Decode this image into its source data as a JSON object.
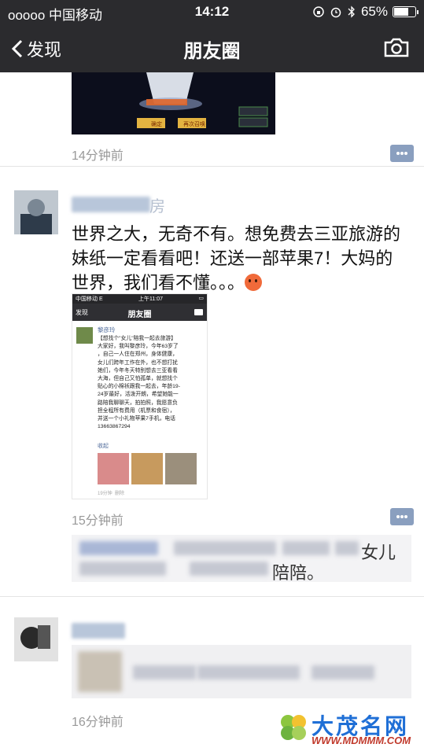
{
  "status_bar": {
    "carrier": "ooooo 中国移动",
    "time": "14:12",
    "battery": "65%",
    "battery_level": 0.65
  },
  "nav": {
    "back_label": "发现",
    "title": "朋友圈",
    "camera_icon": "camera-icon"
  },
  "posts": [
    {
      "timestamp": "14分钟前",
      "image_labels": {
        "button_a": "确定",
        "button_b": "再次召唤"
      }
    },
    {
      "name_suffix": "房",
      "text": "世界之大，无奇不有。想免费去三亚旅游的妹纸一定看看吧！还送一部苹果7！大妈的世界，我们看不懂。。。",
      "timestamp": "15分钟前",
      "shot": {
        "carrier": "中国移动 E",
        "time": "上午11:07",
        "back": "发现",
        "title": "朋友圈",
        "name": "黎彦玲",
        "body": "【想找个\"女儿\"陪我一起去旅游】\n大家好，我叫黎彦玲，今年63岁了\n，自己一人住在郑州，身体健康，\n女儿们跨年工作在外，也不想打扰\n她们，今年冬天特别想去三亚看看\n大海，但自己又怕孤单，就想找个\n贴心的小棉袄跟我一起去，年龄19-\n24岁最好，活泼开朗，希望她能一\n路陪我聊聊天，拍拍照，我愿意负\n担全程所有费用（机票和食宿），\n并送一个小礼物苹果7手机，电话\n13663867294",
        "collapse": "收起",
        "time_ago": "19分钟",
        "delete": "删除"
      },
      "comment_visible": [
        "女儿",
        "陪陪。"
      ]
    },
    {
      "timestamp": "16分钟前"
    }
  ],
  "watermark": {
    "title": "大茂名网",
    "url": "WWW.MDMMM.COM"
  },
  "colors": {
    "nav_bg": "#2b2b2e",
    "link_blue": "#4e6a9a",
    "comment_icon": "#8a9fbf",
    "watermark_blue": "#1f6fd6",
    "watermark_red": "#c0392b"
  }
}
